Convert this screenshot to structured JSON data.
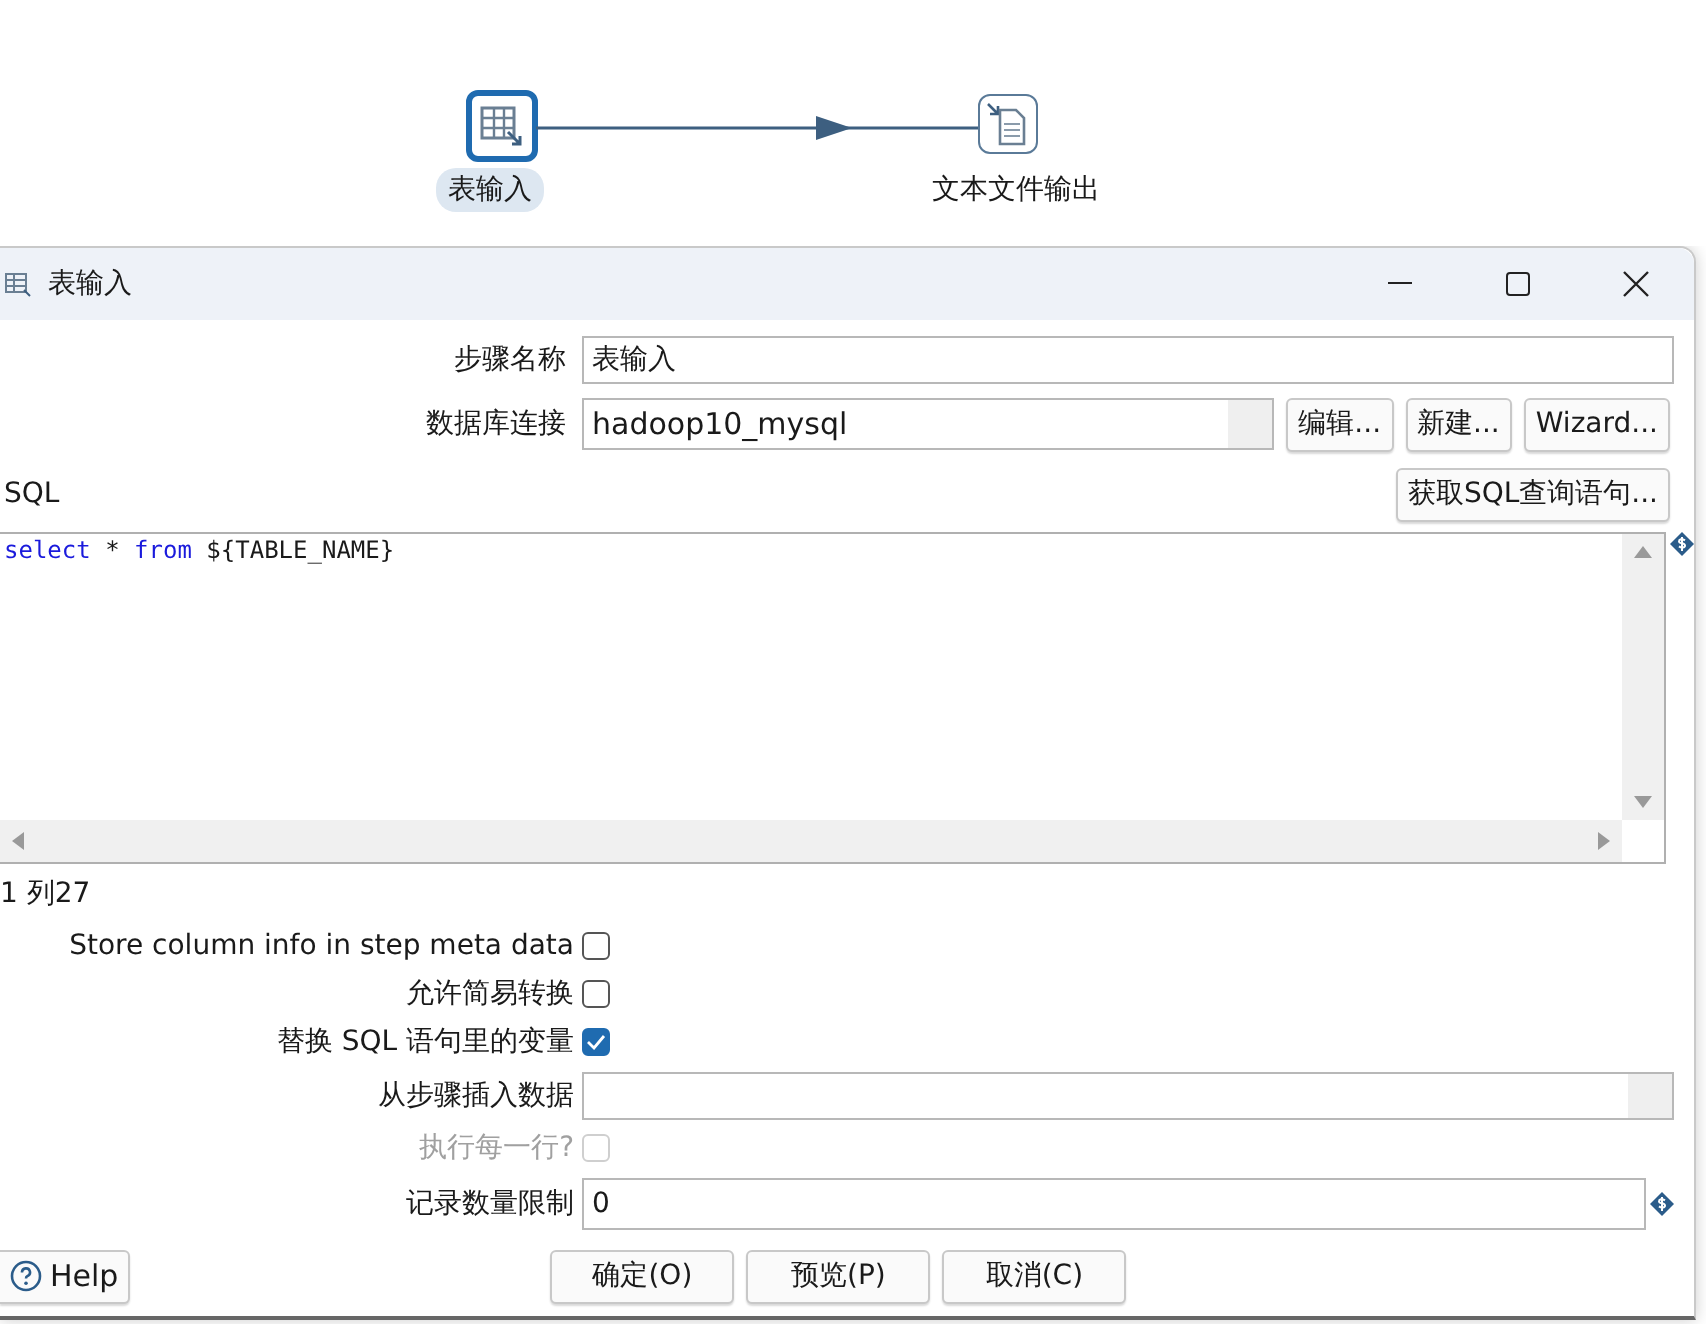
{
  "canvas": {
    "steps": [
      {
        "label": "表输入",
        "selected": true,
        "kind": "table"
      },
      {
        "label": "文本文件输出",
        "selected": false,
        "kind": "file"
      }
    ]
  },
  "dialog": {
    "title": "表输入",
    "step_name": {
      "label": "步骤名称",
      "value": "表输入"
    },
    "connection": {
      "label": "数据库连接",
      "value": "hadoop10_mysql",
      "buttons": [
        "编辑...",
        "新建...",
        "Wizard..."
      ]
    },
    "sql_label": "SQL",
    "get_sql_button": "获取SQL查询语句...",
    "sql_tokens": [
      {
        "text": "select",
        "kind": "keyword"
      },
      {
        "text": " * ",
        "kind": "plain"
      },
      {
        "text": "from",
        "kind": "keyword"
      },
      {
        "text": " ${TABLE_NAME}",
        "kind": "plain"
      }
    ],
    "cursor_position": "1 列27",
    "options": [
      {
        "label": "Store column info in step meta data",
        "checked": false
      },
      {
        "label": "允许简易转换",
        "checked": false
      },
      {
        "label": "替换 SQL 语句里的变量",
        "checked": true
      }
    ],
    "insert_from_step": {
      "label": "从步骤插入数据"
    },
    "execute_each_row": {
      "label": "执行每一行?",
      "checked": false,
      "disabled": true
    },
    "limit": {
      "label": "记录数量限制",
      "value": "0"
    },
    "help_button": "Help",
    "actions": [
      "确定(O)",
      "预览(P)",
      "取消(C)"
    ]
  }
}
